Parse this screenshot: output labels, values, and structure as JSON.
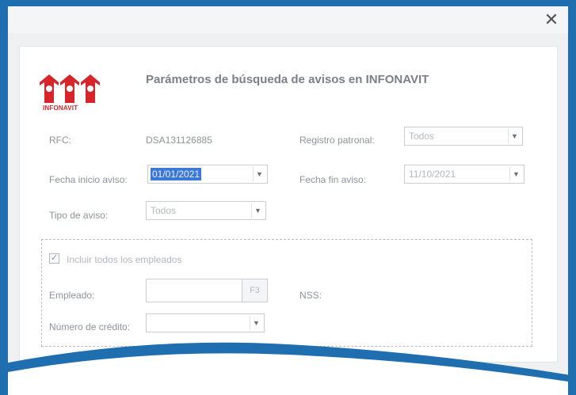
{
  "window": {
    "close_glyph": "✕"
  },
  "logo": {
    "text": "INFONAVIT",
    "icon": "infonavit-houses-logo",
    "color": "#d7262b"
  },
  "title": "Parámetros de búsqueda  de avisos en INFONAVIT",
  "form": {
    "rfc_label": "RFC:",
    "rfc_value": "DSA131126885",
    "registro_label": "Registro patronal:",
    "registro_value": "Todos",
    "fecha_inicio_label": "Fecha inicio aviso:",
    "fecha_inicio_value": "01/01/2021",
    "fecha_fin_label": "Fecha fin aviso:",
    "fecha_fin_value": "11/10/2021",
    "tipo_label": "Tipo de aviso:",
    "tipo_value": "Todos"
  },
  "group": {
    "incluir_label": "Incluir todos los empleados",
    "incluir_checked": true,
    "empleado_label": "Empleado:",
    "empleado_value": "",
    "f3_label": "F3",
    "nss_label": "NSS:",
    "credito_label": "Número de crédito:",
    "credito_value": ""
  },
  "colors": {
    "frame": "#1f6fb0",
    "accent": "#3b78d8"
  }
}
